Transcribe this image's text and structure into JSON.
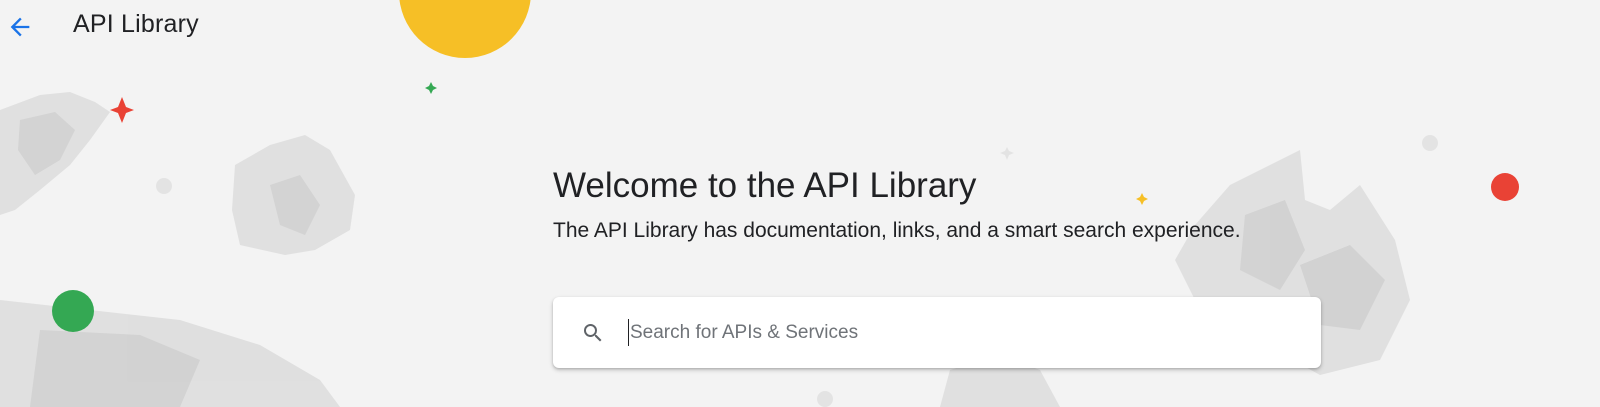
{
  "header": {
    "back_icon": "arrow-left-icon",
    "title": "API Library"
  },
  "welcome": {
    "heading": "Welcome to the API Library",
    "subheading": "The API Library has documentation, links, and a smart search experience."
  },
  "search": {
    "icon": "search-icon",
    "placeholder": "Search for APIs & Services",
    "value": ""
  },
  "colors": {
    "background": "#f3f3f3",
    "accent_blue": "#1a73e8",
    "yellow": "#f6bf26",
    "red": "#e94235",
    "green": "#34a853"
  }
}
